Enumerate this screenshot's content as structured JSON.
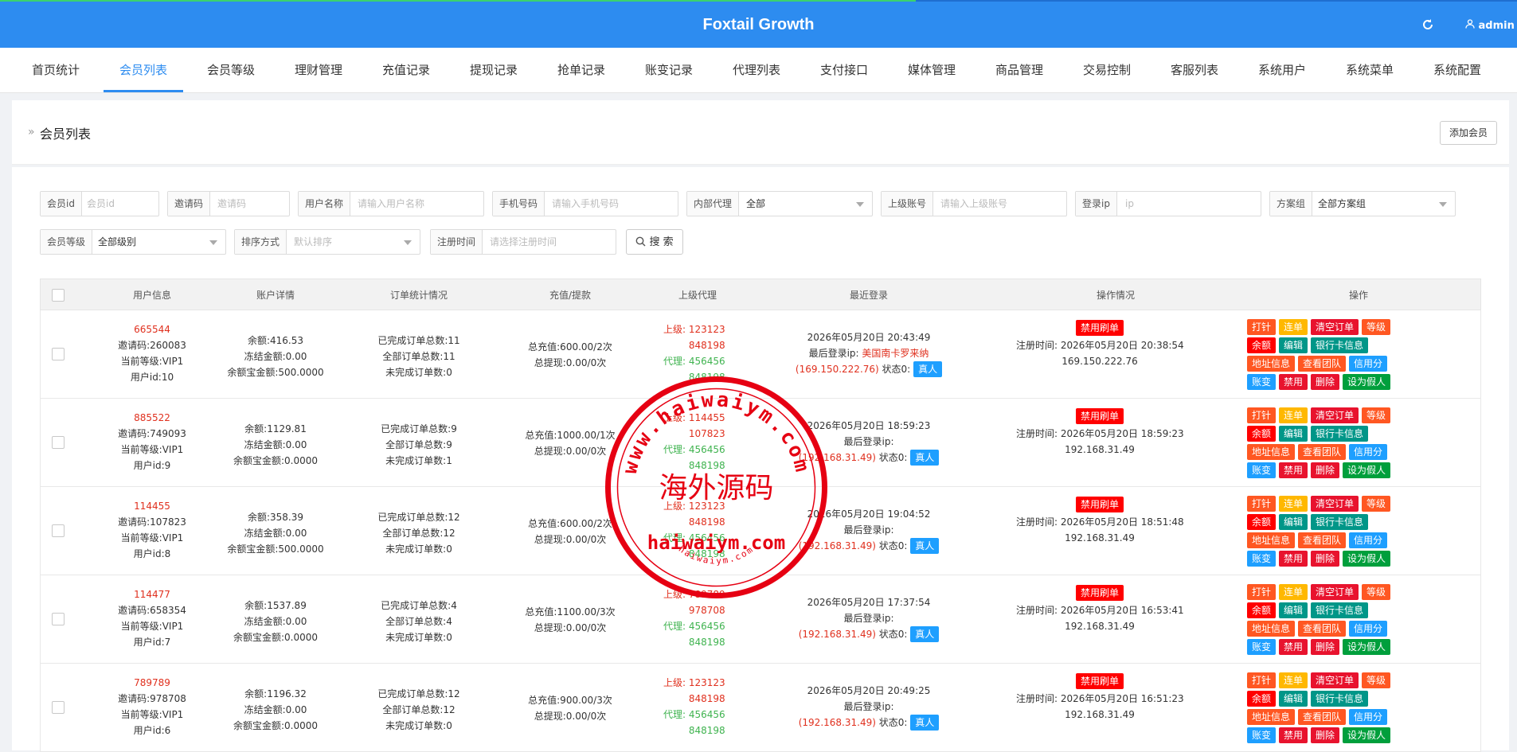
{
  "header": {
    "title": "Foxtail Growth",
    "user": "admin"
  },
  "nav": {
    "tabs": [
      {
        "label": "首页统计"
      },
      {
        "label": "会员列表"
      },
      {
        "label": "会员等级"
      },
      {
        "label": "理财管理"
      },
      {
        "label": "充值记录"
      },
      {
        "label": "提现记录"
      },
      {
        "label": "抢单记录"
      },
      {
        "label": "账变记录"
      },
      {
        "label": "代理列表"
      },
      {
        "label": "支付接口"
      },
      {
        "label": "媒体管理"
      },
      {
        "label": "商品管理"
      },
      {
        "label": "交易控制"
      },
      {
        "label": "客服列表"
      },
      {
        "label": "系统用户"
      },
      {
        "label": "系统菜单"
      },
      {
        "label": "系统配置"
      }
    ],
    "active": "会员列表"
  },
  "panel": {
    "title": "会员列表",
    "add_button": "添加会员"
  },
  "filters": {
    "member_id": {
      "label": "会员id",
      "placeholder": "会员id"
    },
    "invite_code": {
      "label": "邀请码",
      "placeholder": "邀请码"
    },
    "username": {
      "label": "用户名称",
      "placeholder": "请输入用户名称"
    },
    "phone": {
      "label": "手机号码",
      "placeholder": "请输入手机号码"
    },
    "internal_agent": {
      "label": "内部代理",
      "value": "全部"
    },
    "parent_account": {
      "label": "上级账号",
      "placeholder": "请输入上级账号"
    },
    "login_ip": {
      "label": "登录ip",
      "placeholder": "ip"
    },
    "plan_group": {
      "label": "方案组",
      "value": "全部方案组"
    },
    "member_level": {
      "label": "会员等级",
      "value": "全部级别"
    },
    "sort": {
      "label": "排序方式",
      "placeholder": "默认排序"
    },
    "register_time": {
      "label": "注册时间",
      "placeholder": "请选择注册时间"
    },
    "search_button": "搜 索"
  },
  "table": {
    "headers": {
      "user": "用户信息",
      "account": "账户详情",
      "orders": "订单统计情况",
      "recharge": "充值/提款",
      "agent": "上级代理",
      "login": "最近登录",
      "operation": "操作情况",
      "actions": "操作"
    },
    "labels": {
      "parent": "上级:",
      "agent": "代理:",
      "ban_button": "禁用刷单",
      "real": "真人",
      "last_login": "最后登录ip:",
      "status": "状态0:",
      "register": "注册时间:"
    },
    "action_labels": [
      "打针",
      "连单",
      "清空订单",
      "等级",
      "余额",
      "编辑",
      "银行卡信息",
      "地址信息",
      "查看团队",
      "信用分",
      "账变",
      "禁用",
      "删除",
      "设为假人"
    ],
    "rows": [
      {
        "username": "665544",
        "invite": "邀请码:260083",
        "level": "当前等级:VIP1",
        "uid": "用户id:10",
        "balance": "余额:416.53",
        "frozen": "冻结金额:0.00",
        "yeb": "余额宝金额:500.0000",
        "done": "已完成订单总数:11",
        "all": "全部订单总数:11",
        "undone": "未完成订单数:0",
        "recharge": "总充值:600.00/2次",
        "withdraw": "总提现:0.00/0次",
        "parent1": "123123",
        "parent2": "848198",
        "agent1": "456456",
        "agent2": "848198",
        "login_time": "2026年05月20日 20:43:49",
        "login_loc": "美国南卡罗来纳",
        "login_ip": "(169.150.222.76)",
        "reg_time": "2026年05月20日 20:38:54",
        "reg_ip": "169.150.222.76"
      },
      {
        "username": "885522",
        "invite": "邀请码:749093",
        "level": "当前等级:VIP1",
        "uid": "用户id:9",
        "balance": "余额:1129.81",
        "frozen": "冻结金额:0.00",
        "yeb": "余额宝金额:0.0000",
        "done": "已完成订单总数:9",
        "all": "全部订单总数:9",
        "undone": "未完成订单数:1",
        "recharge": "总充值:1000.00/1次",
        "withdraw": "总提现:0.00/0次",
        "parent1": "114455",
        "parent2": "107823",
        "agent1": "456456",
        "agent2": "848198",
        "login_time": "2026年05月20日 18:59:23",
        "login_loc": "",
        "login_ip": "(192.168.31.49)",
        "reg_time": "2026年05月20日 18:59:23",
        "reg_ip": "192.168.31.49"
      },
      {
        "username": "114455",
        "invite": "邀请码:107823",
        "level": "当前等级:VIP1",
        "uid": "用户id:8",
        "balance": "余额:358.39",
        "frozen": "冻结金额:0.00",
        "yeb": "余额宝金额:500.0000",
        "done": "已完成订单总数:12",
        "all": "全部订单总数:12",
        "undone": "未完成订单数:0",
        "recharge": "总充值:600.00/2次",
        "withdraw": "总提现:0.00/0次",
        "parent1": "123123",
        "parent2": "848198",
        "agent1": "456456",
        "agent2": "848198",
        "login_time": "2026年05月20日 19:04:52",
        "login_loc": "",
        "login_ip": "(192.168.31.49)",
        "reg_time": "2026年05月20日 18:51:48",
        "reg_ip": "192.168.31.49"
      },
      {
        "username": "114477",
        "invite": "邀请码:658354",
        "level": "当前等级:VIP1",
        "uid": "用户id:7",
        "balance": "余额:1537.89",
        "frozen": "冻结金额:0.00",
        "yeb": "余额宝金额:0.0000",
        "done": "已完成订单总数:4",
        "all": "全部订单总数:4",
        "undone": "未完成订单数:0",
        "recharge": "总充值:1100.00/3次",
        "withdraw": "总提现:0.00/0次",
        "parent1": "789789",
        "parent2": "978708",
        "agent1": "456456",
        "agent2": "848198",
        "login_time": "2026年05月20日 17:37:54",
        "login_loc": "",
        "login_ip": "(192.168.31.49)",
        "reg_time": "2026年05月20日 16:53:41",
        "reg_ip": "192.168.31.49"
      },
      {
        "username": "789789",
        "invite": "邀请码:978708",
        "level": "当前等级:VIP1",
        "uid": "用户id:6",
        "balance": "余额:1196.32",
        "frozen": "冻结金额:0.00",
        "yeb": "余额宝金额:0.0000",
        "done": "已完成订单总数:12",
        "all": "全部订单总数:12",
        "undone": "未完成订单数:0",
        "recharge": "总充值:900.00/3次",
        "withdraw": "总提现:0.00/0次",
        "parent1": "123123",
        "parent2": "848198",
        "agent1": "456456",
        "agent2": "848198",
        "login_time": "2026年05月20日 20:49:25",
        "login_loc": "",
        "login_ip": "(192.168.31.49)",
        "reg_time": "2026年05月20日 16:51:23",
        "reg_ip": "192.168.31.49"
      }
    ]
  },
  "watermark": {
    "top_ring": "www.haiwaiym.com",
    "center": "海外源码",
    "bottom": "haiwaiym.com",
    "small_ring": "haiwaiym.com"
  }
}
